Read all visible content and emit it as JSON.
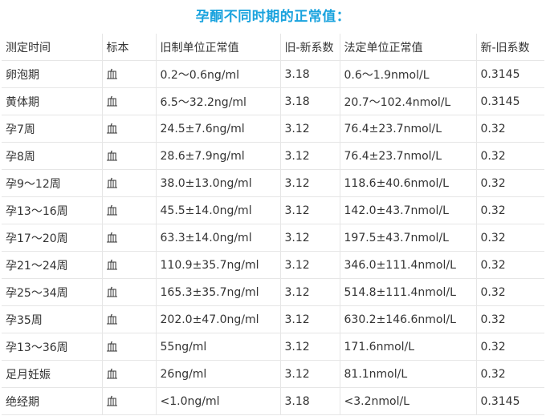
{
  "title": "孕酮不同时期的正常值：",
  "headers": [
    "测定时间",
    "标本",
    "旧制单位正常值",
    "旧-新系数",
    "法定单位正常值",
    "新-旧系数"
  ],
  "rows": [
    [
      "卵泡期",
      "血",
      "0.2～0.6ng/ml",
      "3.18",
      "0.6～1.9nmol/L",
      "0.3145"
    ],
    [
      "黄体期",
      "血",
      "6.5～32.2ng/ml",
      "3.18",
      "20.7～102.4nmol/L",
      "0.3145"
    ],
    [
      "孕7周",
      "血",
      "24.5±7.6ng/ml",
      "3.12",
      "76.4±23.7nmol/L",
      "0.32"
    ],
    [
      "孕8周",
      "血",
      "28.6±7.9ng/ml",
      "3.12",
      "76.4±23.7nmol/L",
      "0.32"
    ],
    [
      "孕9～12周",
      "血",
      "38.0±13.0ng/ml",
      "3.12",
      "118.6±40.6nmol/L",
      "0.32"
    ],
    [
      "孕13～16周",
      "血",
      "45.5±14.0ng/ml",
      "3.12",
      "142.0±43.7nmol/L",
      "0.32"
    ],
    [
      "孕17～20周",
      "血",
      "63.3±14.0ng/ml",
      "3.12",
      "197.5±43.7nmol/L",
      "0.32"
    ],
    [
      "孕21～24周",
      "血",
      "110.9±35.7ng/ml",
      "3.12",
      "346.0±111.4nmol/L",
      "0.32"
    ],
    [
      "孕25～34周",
      "血",
      "165.3±35.7ng/ml",
      "3.12",
      "514.8±111.4nmol/L",
      "0.32"
    ],
    [
      "孕35周",
      "血",
      "202.0±47.0ng/ml",
      "3.12",
      "630.2±146.6nmol/L",
      "0.32"
    ],
    [
      "孕13～36周",
      "血",
      "55ng/ml",
      "3.12",
      "171.6nmol/L",
      "0.32"
    ],
    [
      "足月妊娠",
      "血",
      "26ng/ml",
      "3.12",
      "81.1nmol/L",
      "0.32"
    ],
    [
      "绝经期",
      "血",
      "<1.0ng/ml",
      "3.18",
      "<3.2nmol/L",
      "0.3145"
    ]
  ]
}
